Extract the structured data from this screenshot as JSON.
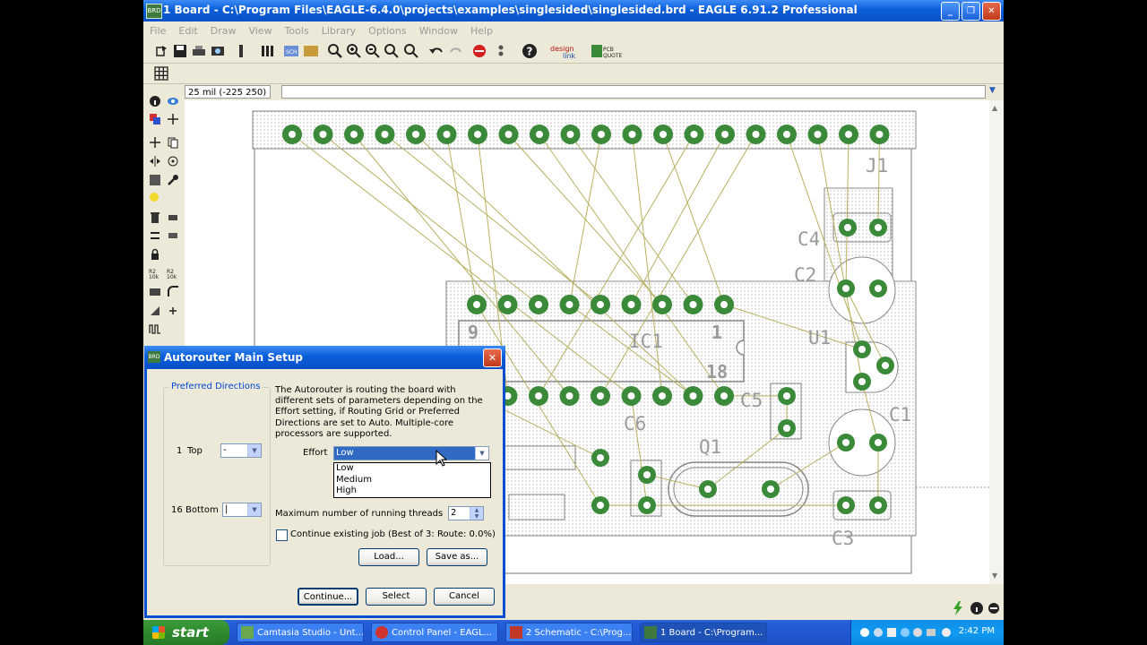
{
  "window": {
    "title": "1 Board - C:\\Program Files\\EAGLE-6.4.0\\projects\\examples\\singlesided\\singlesided.brd - EAGLE 6.91.2 Professional",
    "min_glyph": "_",
    "max_glyph": "❐",
    "close_glyph": "✕"
  },
  "menu": [
    "File",
    "Edit",
    "Draw",
    "View",
    "Tools",
    "Library",
    "Options",
    "Window",
    "Help"
  ],
  "command_bar": {
    "coordinate": "25 mil (-225 250)",
    "command": ""
  },
  "board": {
    "labels": {
      "j1": "J1",
      "c4": "C4",
      "c2": "C2",
      "ic1": "IC1",
      "pin9": "9",
      "pin1": "1",
      "pin18": "18",
      "u1": "U1",
      "c5": "C5",
      "c6": "C6",
      "q1": "Q1",
      "c1": "C1",
      "c3": "C3"
    },
    "colors": {
      "pad": "#3a8a3a",
      "airwire": "#b8b060",
      "outline": "#808080"
    }
  },
  "dialog": {
    "title": "Autorouter Main Setup",
    "preferred_directions_label": "Preferred Directions",
    "layers": [
      {
        "number": "1",
        "name": "Top",
        "value": "-"
      },
      {
        "number": "16",
        "name": "Bottom",
        "value": "|"
      }
    ],
    "description": "The Autorouter is routing the board with different sets of parameters depending on the Effort setting, if Routing Grid or Preferred Directions are set to Auto. Multiple-core processors are supported.",
    "effort_label": "Effort",
    "effort_value": "Low",
    "effort_options": [
      "Low",
      "Medium",
      "High"
    ],
    "hidden_option_text": "...",
    "threads_label": "Maximum number of running threads",
    "threads_value": "2",
    "continue_label": "Continue existing job (Best of 3: Route: 0.0%)",
    "buttons": {
      "load": "Load...",
      "save_as": "Save as...",
      "continue": "Continue...",
      "select": "Select",
      "cancel": "Cancel"
    }
  },
  "taskbar": {
    "start": "start",
    "tasks": [
      {
        "label": "Camtasia Studio - Unt...",
        "icon": "camtasia-icon"
      },
      {
        "label": "Control Panel - EAGL...",
        "icon": "eagle-icon"
      },
      {
        "label": "2 Schematic - C:\\Prog...",
        "icon": "schematic-icon"
      },
      {
        "label": "1 Board - C:\\Program...",
        "icon": "board-icon"
      }
    ],
    "clock": "2:42 PM"
  }
}
